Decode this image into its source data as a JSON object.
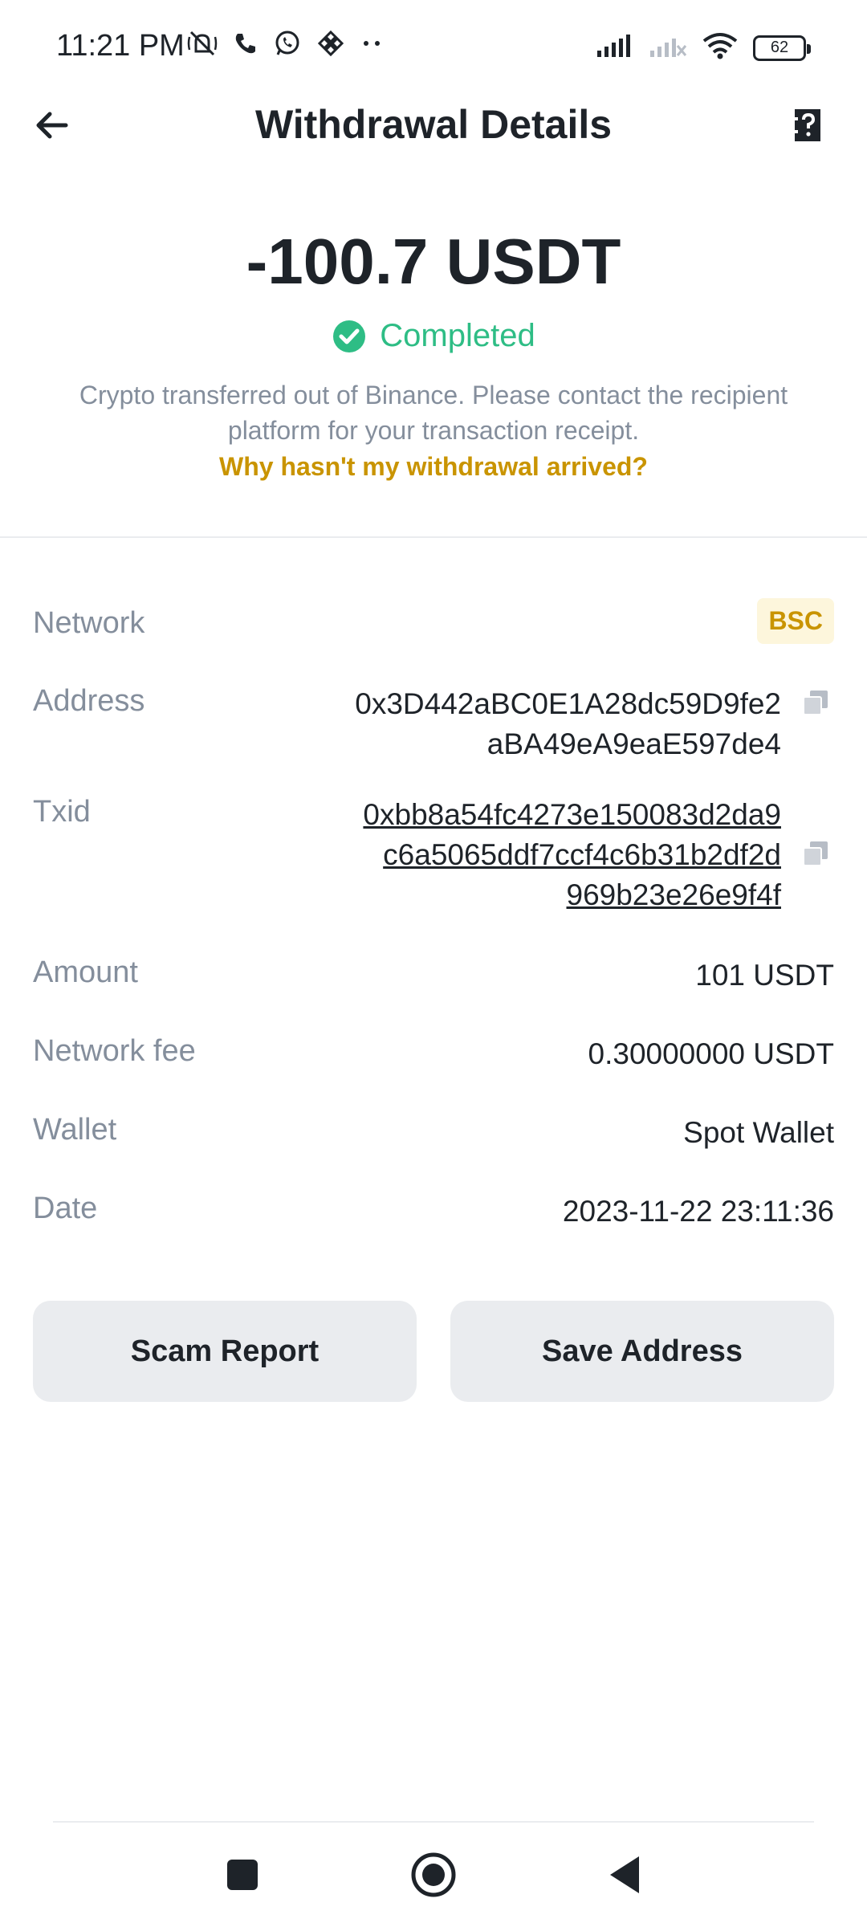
{
  "status_bar": {
    "time": "11:21 PM",
    "battery_level": "62",
    "left_icons": [
      "mute-icon",
      "phone-icon",
      "whatsapp-icon",
      "binance-icon",
      "more-dots-icon"
    ],
    "right_icons": [
      "signal-icon",
      "signal-off-icon",
      "wifi-icon",
      "battery-icon"
    ]
  },
  "header": {
    "title": "Withdrawal Details",
    "back_icon": "arrow-left-icon",
    "help_icon": "help-document-icon"
  },
  "summary": {
    "amount": "-100.7 USDT",
    "status": "Completed",
    "status_color": "#2ebd85",
    "info": "Crypto transferred out of Binance. Please contact the recipient platform for your transaction receipt.",
    "help_link": "Why hasn't my withdrawal arrived?",
    "link_color": "#c99400"
  },
  "details": {
    "network": {
      "label": "Network",
      "value": "BSC"
    },
    "address": {
      "label": "Address",
      "line1": "0x3D442aBC0E1A28dc59D9fe2",
      "line2": "aBA49eA9eaE597de4"
    },
    "txid": {
      "label": "Txid",
      "line1": "0xbb8a54fc4273e150083d2da9",
      "line2": "c6a5065ddf7ccf4c6b31b2df2d",
      "line3": "969b23e26e9f4f"
    },
    "amount": {
      "label": "Amount",
      "value": "101 USDT"
    },
    "network_fee": {
      "label": "Network fee",
      "value": "0.30000000 USDT"
    },
    "wallet": {
      "label": "Wallet",
      "value": "Spot Wallet"
    },
    "date": {
      "label": "Date",
      "value": "2023-11-22 23:11:36"
    }
  },
  "actions": {
    "scam_report": "Scam Report",
    "save_address": "Save Address"
  },
  "nav": {
    "items": [
      "recent-apps-icon",
      "home-icon",
      "back-icon"
    ]
  }
}
